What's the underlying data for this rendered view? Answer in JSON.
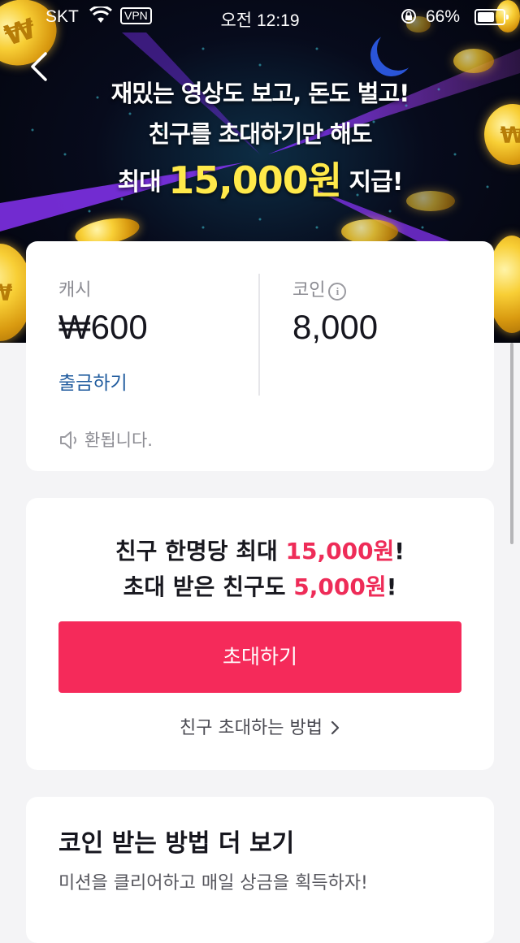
{
  "status_bar": {
    "carrier": "SKT",
    "vpn": "VPN",
    "time": "오전 12:19",
    "battery_pct": "66%",
    "battery_level": 0.66
  },
  "banner": {
    "line1": "재밌는 영상도 보고, 돈도 벌고!",
    "line2": "친구를 초대하기만 해도",
    "line3_prefix": "최대 ",
    "line3_amount": "15,000원",
    "line3_suffix": " 지급!",
    "coin_symbol": "₩"
  },
  "balance_card": {
    "cash_label": "캐시",
    "cash_value": "₩600",
    "withdraw_link": "출금하기",
    "coin_label": "코인",
    "coin_value": "8,000",
    "notice_text": "환됩니다."
  },
  "invite_card": {
    "line1_prefix": "친구 한명당 최대 ",
    "line1_amount": "15,000원",
    "line1_suffix": "!",
    "line2_prefix": "초대 받은 친구도 ",
    "line2_amount": "5,000원",
    "line2_suffix": "!",
    "invite_button": "초대하기",
    "howto_link": "친구 초대하는 방법"
  },
  "more_card": {
    "title": "코인 받는 방법 더 보기",
    "subtitle": "미션을 클리어하고 매일 상금을 획득하자!"
  },
  "colors": {
    "accent_pink": "#f52a5a",
    "link_blue": "#1f5b9e",
    "gold": "#ffe94a"
  },
  "icons": {
    "back": "chevron-left-icon",
    "info": "info-icon",
    "speaker": "speaker-icon",
    "chevron": "chevron-right-icon"
  }
}
